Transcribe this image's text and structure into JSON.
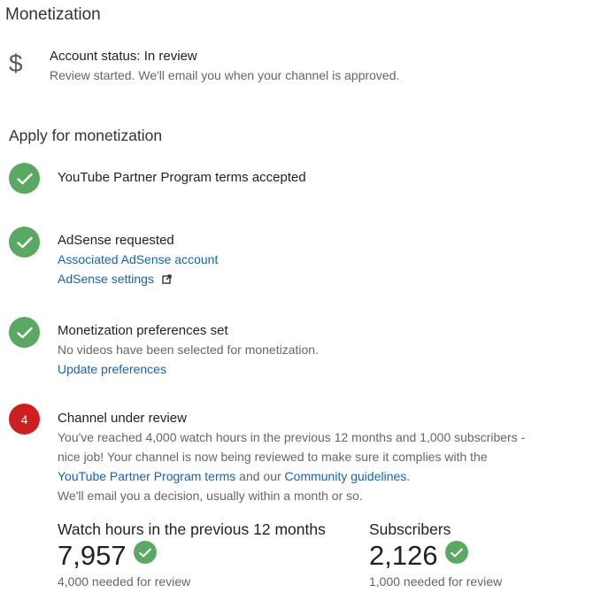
{
  "page": {
    "title": "Monetization"
  },
  "status": {
    "icon": "dollar-icon",
    "symbol": "$",
    "title": "Account status: In review",
    "subtitle": "Review started. We'll email you when your channel is approved."
  },
  "apply": {
    "title": "Apply for monetization",
    "steps": [
      {
        "state": "done",
        "title": "YouTube Partner Program terms accepted"
      },
      {
        "state": "done",
        "title": "AdSense requested",
        "links": [
          "Associated AdSense account",
          "AdSense settings"
        ]
      },
      {
        "state": "done",
        "title": "Monetization preferences set",
        "text": "No videos have been selected for monetization.",
        "link": "Update preferences"
      },
      {
        "state": "current",
        "number": "4",
        "title": "Channel under review",
        "desc_part1": "You've reached 4,000 watch hours in the previous 12 months and 1,000 subscribers - nice job! Your channel is now being reviewed to make sure it complies with the ",
        "desc_link1": "YouTube Partner Program terms",
        "desc_part2": " and our ",
        "desc_link2": "Community guidelines",
        "desc_part3": ".",
        "desc_line2": "We'll email you a decision, usually within a month or so."
      }
    ]
  },
  "metrics": {
    "watch_hours": {
      "label": "Watch hours in the previous 12 months",
      "value": "7,957",
      "needed": "4,000 needed for review"
    },
    "subscribers": {
      "label": "Subscribers",
      "value": "2,126",
      "needed": "1,000 needed for review"
    }
  },
  "colors": {
    "success": "#5aa864",
    "alert": "#cc1f1f",
    "link": "#1a63a6"
  }
}
